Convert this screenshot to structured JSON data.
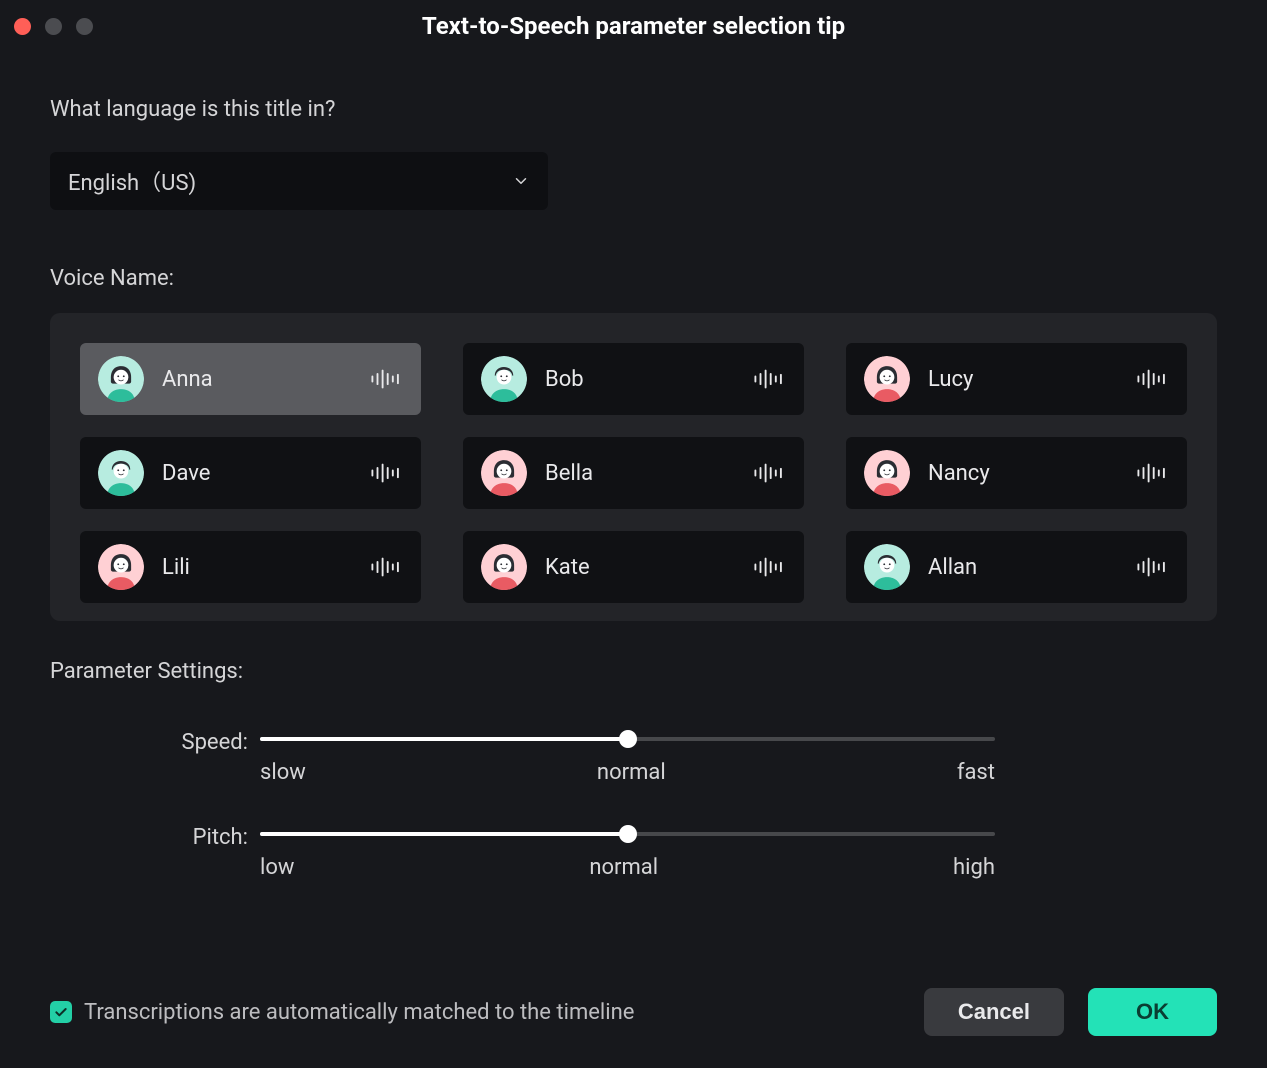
{
  "window": {
    "title": "Text-to-Speech parameter selection tip"
  },
  "language": {
    "question": "What language is this title in?",
    "selected": "English（US)"
  },
  "voices": {
    "label": "Voice Name:",
    "list": [
      {
        "name": "Anna",
        "gender": "female",
        "color": "teal",
        "selected": true
      },
      {
        "name": "Bob",
        "gender": "male",
        "color": "teal",
        "selected": false
      },
      {
        "name": "Lucy",
        "gender": "female",
        "color": "pink",
        "selected": false
      },
      {
        "name": "Dave",
        "gender": "male",
        "color": "teal",
        "selected": false
      },
      {
        "name": "Bella",
        "gender": "female",
        "color": "pink",
        "selected": false
      },
      {
        "name": "Nancy",
        "gender": "female",
        "color": "pink",
        "selected": false
      },
      {
        "name": "Lili",
        "gender": "female",
        "color": "pink",
        "selected": false
      },
      {
        "name": "Kate",
        "gender": "female",
        "color": "pink",
        "selected": false
      },
      {
        "name": "Allan",
        "gender": "male",
        "color": "teal",
        "selected": false
      }
    ]
  },
  "parameters": {
    "label": "Parameter Settings:",
    "speed": {
      "label": "Speed:",
      "value_percent": 50,
      "min_label": "slow",
      "mid_label": "normal",
      "max_label": "fast"
    },
    "pitch": {
      "label": "Pitch:",
      "value_percent": 50,
      "min_label": "low",
      "mid_label": "normal",
      "max_label": "high"
    }
  },
  "transcription": {
    "checked": true,
    "label": "Transcriptions are automatically matched to the timeline"
  },
  "buttons": {
    "cancel": "Cancel",
    "ok": "OK"
  }
}
